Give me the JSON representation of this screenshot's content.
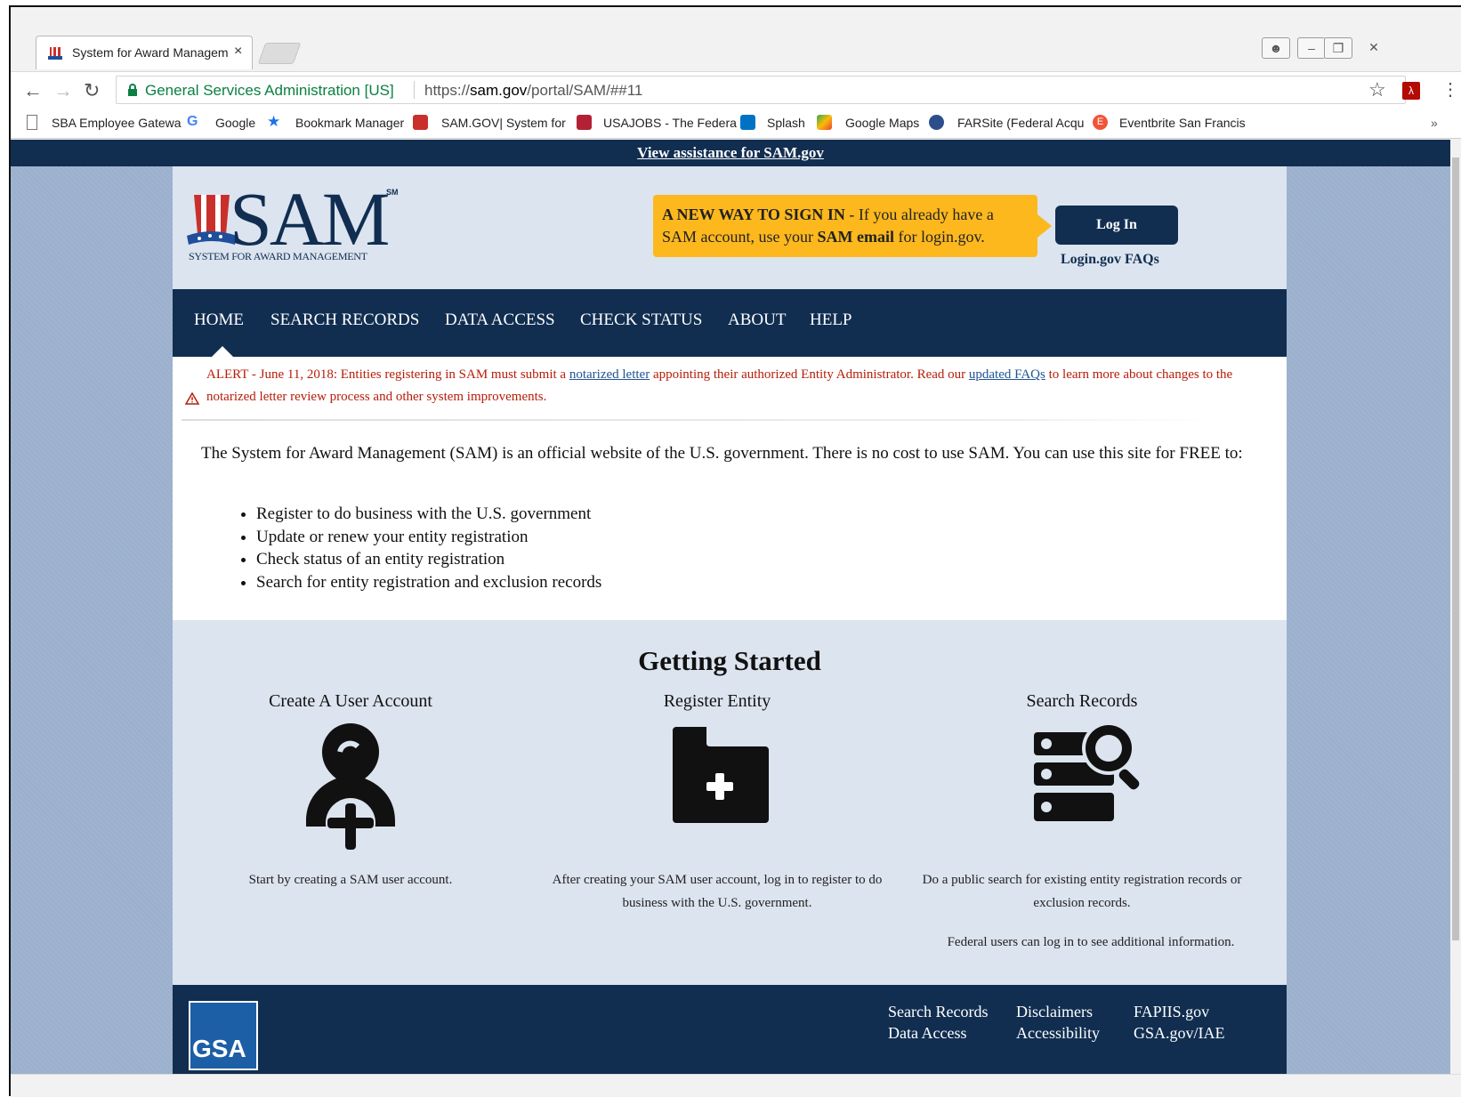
{
  "browser": {
    "tab_title": "System for Award Managem",
    "tab_close": "×",
    "org_name": "General Services Administration [US]",
    "url_prefix": "https://",
    "url_host": "sam.gov",
    "url_path": "/portal/SAM/##11",
    "bookmarks": [
      {
        "label": "SBA Employee Gatewa",
        "icon": "page-icon"
      },
      {
        "label": "Google",
        "icon": "google-icon"
      },
      {
        "label": "Bookmark Manager",
        "icon": "star-icon"
      },
      {
        "label": "SAM.GOV| System for",
        "icon": "sam-hat-icon"
      },
      {
        "label": "USAJOBS - The Federa",
        "icon": "usajobs-icon"
      },
      {
        "label": "Splash",
        "icon": "sharepoint-icon"
      },
      {
        "label": "Google Maps",
        "icon": "maps-icon"
      },
      {
        "label": "FARSite (Federal Acqu",
        "icon": "farsite-icon"
      },
      {
        "label": "Eventbrite San Francis",
        "icon": "eventbrite-icon"
      }
    ],
    "bookmarks_overflow": "»"
  },
  "assist_link": "View assistance for SAM.gov",
  "header": {
    "logo_text": "SAM",
    "logo_sm": "SM",
    "logo_subtitle": "SYSTEM FOR AWARD MANAGEMENT",
    "notice_bold1": "A NEW WAY TO SIGN IN",
    "notice_text1": " - If you already have a SAM account, use your ",
    "notice_bold2": "SAM email",
    "notice_text2": " for login.gov.",
    "login_label": "Log In",
    "login_faq": "Login.gov FAQs"
  },
  "nav": [
    "HOME",
    "SEARCH RECORDS",
    "DATA ACCESS",
    "CHECK STATUS",
    "ABOUT",
    "HELP"
  ],
  "alert": {
    "part1": "ALERT - June 11, 2018: Entities registering in SAM must submit a ",
    "link1": "notarized letter",
    "part2": " appointing their authorized Entity Administrator. Read our ",
    "link2": "updated FAQs",
    "part3": " to learn more about changes to the notarized letter review process and other system improvements."
  },
  "intro": {
    "paragraph": "The System for Award Management (SAM) is an official website of the U.S. government. There is no cost to use SAM. You can use this site for FREE to:",
    "items": [
      "Register to do business with the U.S. government",
      "Update or renew your entity registration",
      "Check status of an entity registration",
      "Search for entity registration and exclusion records"
    ]
  },
  "getting_started": {
    "title": "Getting Started",
    "columns": [
      {
        "heading": "Create A User Account",
        "icon": "user-add-icon",
        "desc": "Start by creating a SAM user account."
      },
      {
        "heading": "Register Entity",
        "icon": "folder-add-icon",
        "desc": "After creating your SAM user account, log in to register to do business with the U.S. government."
      },
      {
        "heading": "Search Records",
        "icon": "database-search-icon",
        "desc": "Do a public search for existing entity registration records or exclusion records.",
        "note": "Federal users can log in to see additional information."
      }
    ]
  },
  "footer": {
    "logo": "GSA",
    "links": [
      "Search Records",
      "Data Access",
      "Disclaimers",
      "Accessibility",
      "FAPIIS.gov",
      "GSA.gov/IAE"
    ]
  },
  "colors": {
    "navy": "#112e51",
    "gold": "#fdb81e",
    "alert_red": "#b51d09",
    "page_bg": "#dce4ef"
  }
}
